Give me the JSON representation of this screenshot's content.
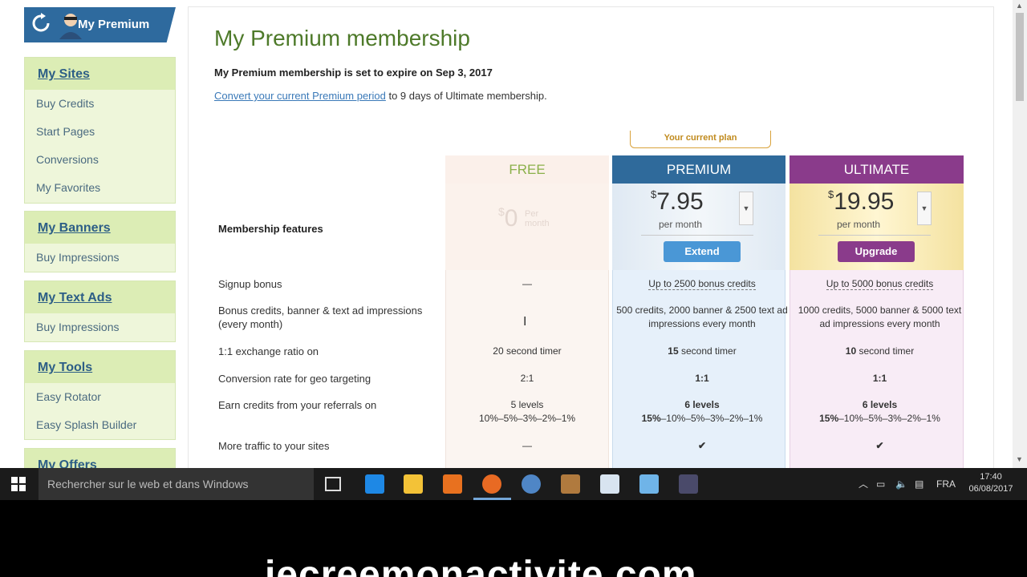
{
  "sidebar": {
    "brand": "My Premium",
    "groups": [
      {
        "title": "My Sites",
        "items": [
          "Buy Credits",
          "Start Pages",
          "Conversions",
          "My Favorites"
        ]
      },
      {
        "title": "My Banners",
        "items": [
          "Buy Impressions"
        ]
      },
      {
        "title": "My Text Ads",
        "items": [
          "Buy Impressions"
        ]
      },
      {
        "title": "My Tools",
        "items": [
          "Easy Rotator",
          "Easy Splash Builder"
        ]
      },
      {
        "title": "My Offers",
        "items": []
      }
    ]
  },
  "main": {
    "title": "My Premium membership",
    "expire_text": "My Premium membership is set to expire on Sep 3, 2017",
    "convert_link": "Convert your current Premium period",
    "convert_rest": " to 9 days of Ultimate membership."
  },
  "plans": {
    "current_label": "Your current plan",
    "features_title": "Membership features",
    "free": {
      "name": "FREE",
      "currency": "$",
      "amount": "0",
      "per": "Per month"
    },
    "premium": {
      "name": "PREMIUM",
      "currency": "$",
      "amount": "7.95",
      "per": "per month",
      "button": "Extend"
    },
    "ultimate": {
      "name": "ULTIMATE",
      "currency": "$",
      "amount": "19.95",
      "per": "per month",
      "button": "Upgrade"
    }
  },
  "features": [
    {
      "label": "Signup bonus",
      "free": "—",
      "premium": "Up to 2500 bonus credits",
      "ultimate": "Up to 5000 bonus credits"
    },
    {
      "label": "Bonus credits, banner & text ad impressions (every month)",
      "free": "",
      "premium": "500 credits, 2000 banner & 2500 text ad impressions every month",
      "ultimate": "1000 credits, 5000 banner & 5000 text ad impressions every month"
    },
    {
      "label": "1:1 exchange ratio on",
      "free": "20 second timer",
      "premium_bold": "15",
      "premium": " second timer",
      "ultimate_bold": "10",
      "ultimate": " second timer"
    },
    {
      "label": "Conversion rate for geo targeting",
      "free": "2:1",
      "premium": "1:1",
      "ultimate": "1:1"
    },
    {
      "label": "Earn credits from your referrals on",
      "free_l1": "5 levels",
      "free_l2": "10%–5%–3%–2%–1%",
      "prem_l1": "6 levels",
      "prem_l2_bold": "15%",
      "prem_l2": "–10%–5%–3%–2%–1%",
      "ult_l1": "6 levels",
      "ult_l2_bold": "15%",
      "ult_l2": "–10%–5%–3%–2%–1%"
    },
    {
      "label": "More traffic to your sites",
      "free": "—",
      "premium": "✔",
      "ultimate": "✔"
    }
  ],
  "taskbar": {
    "search_placeholder": "Rechercher sur le web et dans Windows",
    "language": "FRA",
    "time": "17:40",
    "date": "06/08/2017"
  },
  "overlay": {
    "watermark": "jecreemonactivite.com"
  },
  "colors": {
    "premium": "#2f6a9b",
    "ultimate": "#8a3b8b",
    "free_text": "#8bb04a",
    "title_green": "#4e7a2a"
  }
}
